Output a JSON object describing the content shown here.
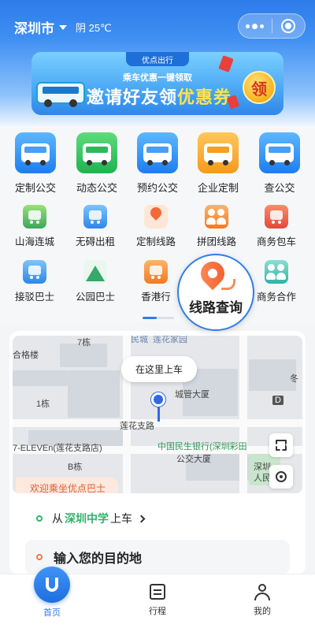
{
  "header": {
    "city": "深圳市",
    "weather": "阴 25℃"
  },
  "banner": {
    "brand": "优点出行",
    "subtitle": "乘车优惠一键领取",
    "title_plain": "邀请好友领",
    "title_highlight": "优惠券",
    "badge": "领"
  },
  "services_main": [
    {
      "label": "定制公交",
      "icon": "bus-icon",
      "color": "#2a86ee"
    },
    {
      "label": "动态公交",
      "icon": "bus-icon",
      "color": "#2bb856"
    },
    {
      "label": "预约公交",
      "icon": "bus-icon",
      "color": "#2a86ee"
    },
    {
      "label": "企业定制",
      "icon": "bus-icon",
      "color": "#f6a026"
    },
    {
      "label": "查公交",
      "icon": "bus-icon",
      "color": "#2a86ee"
    }
  ],
  "services_secondary": [
    {
      "label": "山海连城",
      "icon": "bus-icon"
    },
    {
      "label": "无碍出租",
      "icon": "taxi-icon"
    },
    {
      "label": "定制线路",
      "icon": "route-pin-icon"
    },
    {
      "label": "拼团线路",
      "icon": "group-icon"
    },
    {
      "label": "商务包车",
      "icon": "bus-icon"
    },
    {
      "label": "接驳巴士",
      "icon": "shuttle-icon"
    },
    {
      "label": "公园巴士",
      "icon": "mountain-icon"
    },
    {
      "label": "香港行",
      "icon": "car-icon"
    },
    {
      "label": "线路查询",
      "icon": "route-search-icon"
    },
    {
      "label": "商务合作",
      "icon": "people-icon"
    }
  ],
  "map": {
    "pickup_bubble": "在这里上车",
    "labels": {
      "building7": "7栋",
      "building1": "1栋",
      "buildingB": "B栋",
      "hege": "合格楼",
      "cityhall": "城管大厦",
      "road": "莲花支路",
      "store": "7-ELEVEn(莲花支路店)",
      "bank": "中国民生银行(深圳彩田",
      "bus_building": "公交大厦",
      "shenzhen": "深圳",
      "renmin": "人民",
      "mindan": "民城",
      "lianxi": "莲花家园",
      "dong": "冬",
      "d_badge": "D"
    },
    "welcome": "欢迎乘坐优点巴士"
  },
  "boarding": {
    "prefix": "从",
    "station": "深圳中学",
    "suffix": "上车"
  },
  "destination": {
    "placeholder": "输入您的目的地"
  },
  "tabbar": {
    "home": "首页",
    "trips": "行程",
    "me": "我的"
  },
  "colors": {
    "accent": "#2f7de8",
    "station_green": "#2fb36a",
    "welcome_orange": "#e05a37"
  }
}
